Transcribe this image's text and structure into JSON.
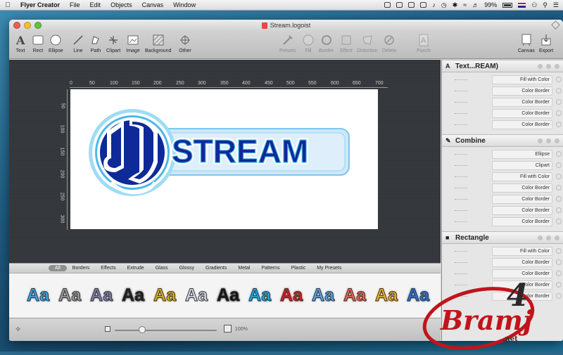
{
  "menubar": {
    "app_name": "Flyer Creator",
    "menus": [
      "File",
      "Edit",
      "Objects",
      "Canvas",
      "Window"
    ],
    "battery": "99%"
  },
  "window": {
    "title": "Stream.logoist"
  },
  "toolbar": {
    "left_tools": [
      {
        "label": "Text",
        "icon": "text-tool-icon"
      },
      {
        "label": "Rect",
        "icon": "rect-tool-icon"
      },
      {
        "label": "Ellipse",
        "icon": "ellipse-tool-icon"
      },
      {
        "label": "Line",
        "icon": "line-tool-icon"
      },
      {
        "label": "Path",
        "icon": "path-tool-icon"
      },
      {
        "label": "Clipart",
        "icon": "clipart-tool-icon"
      },
      {
        "label": "Image",
        "icon": "image-tool-icon"
      },
      {
        "label": "Background",
        "icon": "background-tool-icon"
      },
      {
        "label": "Other",
        "icon": "other-tool-icon"
      }
    ],
    "middle_tools": [
      {
        "label": "Presets",
        "icon": "presets-icon"
      },
      {
        "label": "Fill",
        "icon": "fill-icon"
      },
      {
        "label": "Border",
        "icon": "border-icon"
      },
      {
        "label": "Effect",
        "icon": "effect-icon"
      },
      {
        "label": "Distortion",
        "icon": "distortion-icon"
      },
      {
        "label": "Delete",
        "icon": "delete-icon"
      },
      {
        "label": "Punch",
        "icon": "punch-icon"
      }
    ],
    "right_tools": [
      {
        "label": "Canvas",
        "icon": "canvas-icon"
      },
      {
        "label": "Export",
        "icon": "export-icon"
      }
    ]
  },
  "rulers": {
    "top": [
      "0",
      "50",
      "100",
      "150",
      "200",
      "250",
      "300",
      "350",
      "400",
      "450",
      "500",
      "550",
      "600",
      "650",
      "700"
    ],
    "left": [
      "50",
      "100",
      "150",
      "200",
      "250",
      "300"
    ]
  },
  "artboard": {
    "logo_text": "STREAM"
  },
  "inspector": {
    "sections": [
      {
        "title": "Text...REAM)",
        "icon": "A",
        "rows": [
          "Fill with Color",
          "Color Border",
          "Color Border",
          "Color Border",
          "Color Border"
        ]
      },
      {
        "title": "Combine",
        "icon": "✎",
        "rows": [
          "Ellipse",
          "Clipart",
          "Fill with Color",
          "Color Border",
          "Color Border",
          "Color Border",
          "Color Border"
        ]
      },
      {
        "title": "Rectangle",
        "icon": "■",
        "rows": [
          "Fill with Color",
          "Color Border",
          "Color Border",
          "Color Border",
          "Color Border"
        ]
      }
    ]
  },
  "style_filters": {
    "items": [
      "All",
      "Borders",
      "Effects",
      "Extrude",
      "Glass",
      "Glossy",
      "Gradients",
      "Metal",
      "Patterns",
      "Plastic",
      "My Presets"
    ],
    "active": "All"
  },
  "style_samples": {
    "glyph": "Aa",
    "colors": [
      "#3aa7e8",
      "#9a9a9a",
      "#7e7ea6",
      "#1d1d1d",
      "#d9b21a",
      "#d7dbe8",
      "#111111",
      "#1da7e6",
      "#d41f1f",
      "#5aa3e6",
      "#e9664f",
      "#f0b22a",
      "#2f6fd6"
    ]
  },
  "statusbar": {
    "zoom": "100%"
  },
  "watermark": {
    "line1": "4",
    "line2": "Bramj",
    "line3": ".net"
  }
}
